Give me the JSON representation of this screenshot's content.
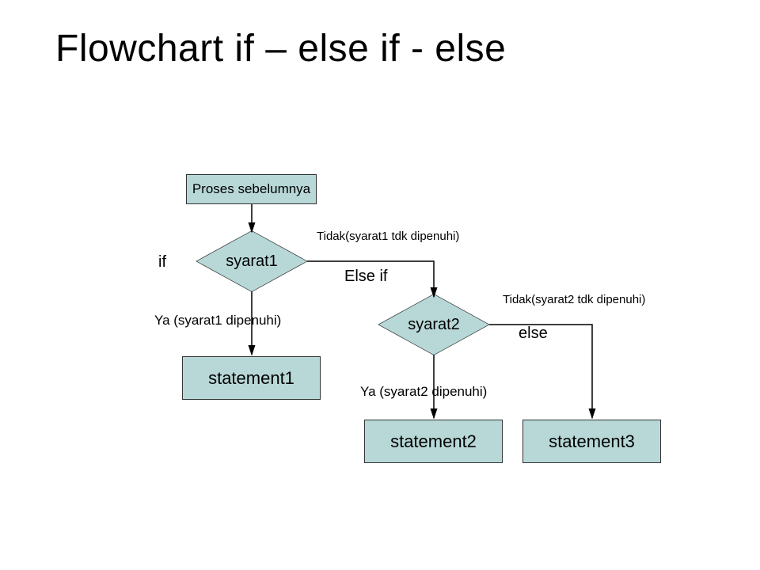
{
  "title": "Flowchart if – else if - else",
  "nodes": {
    "proses": "Proses sebelumnya",
    "syarat1": "syarat1",
    "syarat2": "syarat2",
    "statement1": "statement1",
    "statement2": "statement2",
    "statement3": "statement3"
  },
  "labels": {
    "if": "if",
    "else_if": "Else if",
    "else": "else",
    "ya1": "Ya (syarat1 dipenuhi)",
    "ya2": "Ya (syarat2 dipenuhi)",
    "tidak1": "Tidak(syarat1 tdk dipenuhi)",
    "tidak2": "Tidak(syarat2 tdk dipenuhi)"
  },
  "colors": {
    "node_fill": "#b8d8d8",
    "stroke": "#333333"
  }
}
